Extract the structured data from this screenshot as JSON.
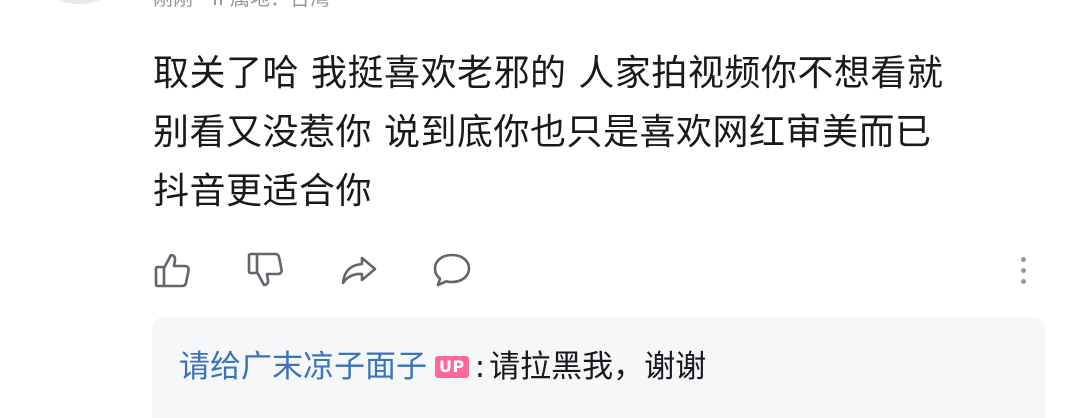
{
  "comment": {
    "meta": "刚刚 · IP属地：台湾",
    "lines": [
      "取关了哈 我挺喜欢老邪的 人家拍视频你不想看就",
      "别看又没惹你 说到底你也只是喜欢网红审美而已",
      "抖音更适合你"
    ]
  },
  "actions": {
    "icons": [
      "thumbs-up-icon",
      "thumbs-down-icon",
      "share-icon",
      "comment-icon",
      "more-vertical-icon"
    ]
  },
  "reply": {
    "user": "请给广末凉子面子",
    "badge": "UP",
    "colon": ":",
    "text": "请拉黑我，谢谢"
  },
  "colors": {
    "text": "#18191c",
    "muted": "#9499a0",
    "link": "#3b72b8",
    "badge": "#ff6699",
    "reply_bg": "#f6f7f8",
    "icon": "#61666d"
  }
}
